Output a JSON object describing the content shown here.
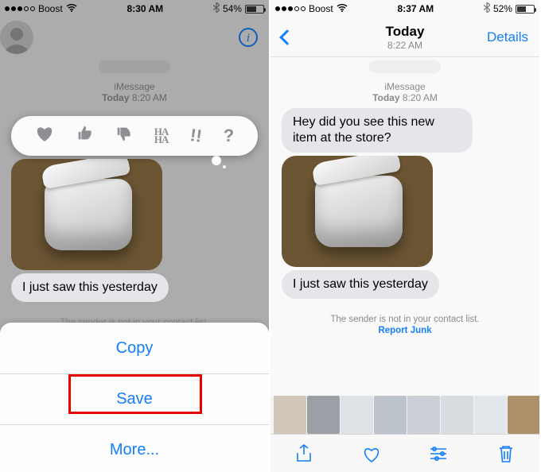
{
  "left": {
    "status": {
      "carrier": "Boost",
      "time": "8:30 AM",
      "battery_pct": "54%",
      "battery_fill": 54
    },
    "nav": {
      "details": "Details"
    },
    "stamp": {
      "service": "iMessage",
      "day": "Today",
      "time": "8:20 AM"
    },
    "messages": {
      "reply": "I just saw this yesterday"
    },
    "contact_warning": "The sender is not in your contact list.",
    "tapback": {
      "haha": "HA\nHA"
    },
    "sheet": {
      "copy": "Copy",
      "save": "Save",
      "more": "More..."
    }
  },
  "right": {
    "status": {
      "carrier": "Boost",
      "time": "8:37 AM",
      "battery_pct": "52%",
      "battery_fill": 52
    },
    "nav": {
      "title": "Today",
      "subtitle": "8:22 AM",
      "details": "Details"
    },
    "stamp": {
      "service": "iMessage",
      "day": "Today",
      "time": "8:20 AM"
    },
    "messages": {
      "incoming": "Hey did you see this new item at the store?",
      "reply": "I just saw this yesterday"
    },
    "contact_warning": "The sender is not in your contact list.",
    "report_junk": "Report Junk"
  }
}
